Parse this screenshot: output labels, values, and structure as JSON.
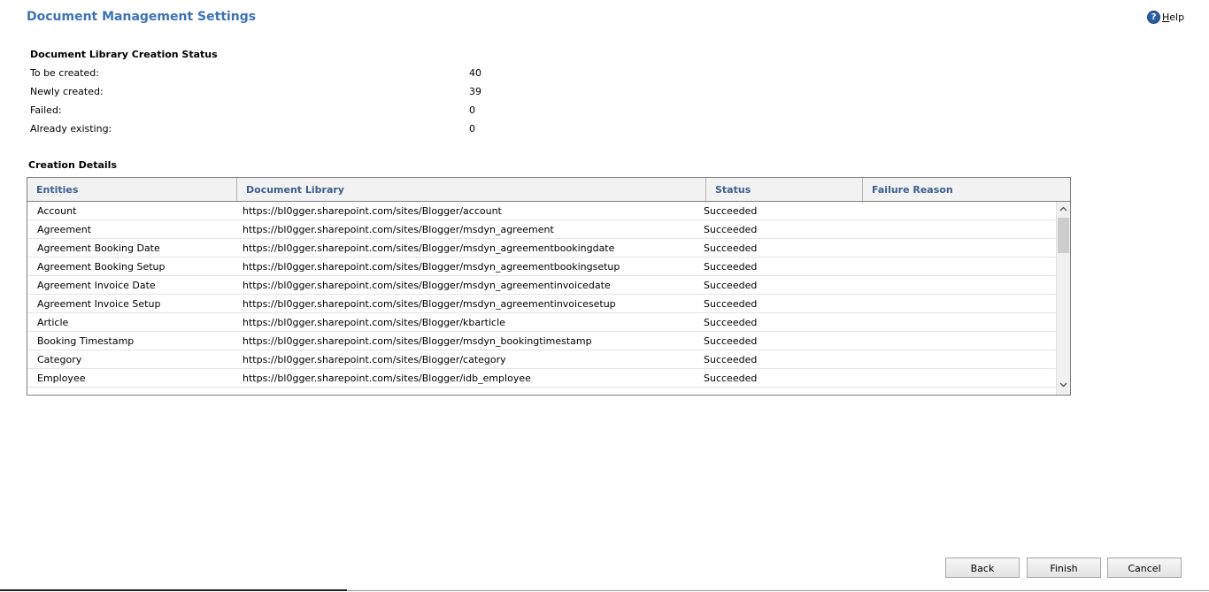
{
  "page": {
    "title": "Document Management Settings",
    "help_label": "Help"
  },
  "status": {
    "heading": "Document Library Creation Status",
    "rows": [
      {
        "label": "To be created:",
        "value": "40"
      },
      {
        "label": "Newly created:",
        "value": "39"
      },
      {
        "label": "Failed:",
        "value": "0"
      },
      {
        "label": "Already existing:",
        "value": "0"
      }
    ]
  },
  "details": {
    "heading": "Creation Details",
    "columns": [
      "Entities",
      "Document Library",
      "Status",
      "Failure Reason"
    ],
    "rows": [
      {
        "entity": "Account",
        "library": "https://bl0gger.sharepoint.com/sites/Blogger/account",
        "status": "Succeeded",
        "reason": ""
      },
      {
        "entity": "Agreement",
        "library": "https://bl0gger.sharepoint.com/sites/Blogger/msdyn_agreement",
        "status": "Succeeded",
        "reason": ""
      },
      {
        "entity": "Agreement Booking Date",
        "library": "https://bl0gger.sharepoint.com/sites/Blogger/msdyn_agreementbookingdate",
        "status": "Succeeded",
        "reason": ""
      },
      {
        "entity": "Agreement Booking Setup",
        "library": "https://bl0gger.sharepoint.com/sites/Blogger/msdyn_agreementbookingsetup",
        "status": "Succeeded",
        "reason": ""
      },
      {
        "entity": "Agreement Invoice Date",
        "library": "https://bl0gger.sharepoint.com/sites/Blogger/msdyn_agreementinvoicedate",
        "status": "Succeeded",
        "reason": ""
      },
      {
        "entity": "Agreement Invoice Setup",
        "library": "https://bl0gger.sharepoint.com/sites/Blogger/msdyn_agreementinvoicesetup",
        "status": "Succeeded",
        "reason": ""
      },
      {
        "entity": "Article",
        "library": "https://bl0gger.sharepoint.com/sites/Blogger/kbarticle",
        "status": "Succeeded",
        "reason": ""
      },
      {
        "entity": "Booking Timestamp",
        "library": "https://bl0gger.sharepoint.com/sites/Blogger/msdyn_bookingtimestamp",
        "status": "Succeeded",
        "reason": ""
      },
      {
        "entity": "Category",
        "library": "https://bl0gger.sharepoint.com/sites/Blogger/category",
        "status": "Succeeded",
        "reason": ""
      },
      {
        "entity": "Employee",
        "library": "https://bl0gger.sharepoint.com/sites/Blogger/idb_employee",
        "status": "Succeeded",
        "reason": ""
      }
    ]
  },
  "buttons": {
    "back": "Back",
    "finish": "Finish",
    "cancel": "Cancel"
  },
  "icons": {
    "help": "help-icon",
    "scroll_up": "chevron-up-icon",
    "scroll_down": "chevron-down-icon"
  },
  "colors": {
    "title": "#3b73b9",
    "column_header": "#3b5f8e",
    "help_icon": "#2b5ea8"
  }
}
